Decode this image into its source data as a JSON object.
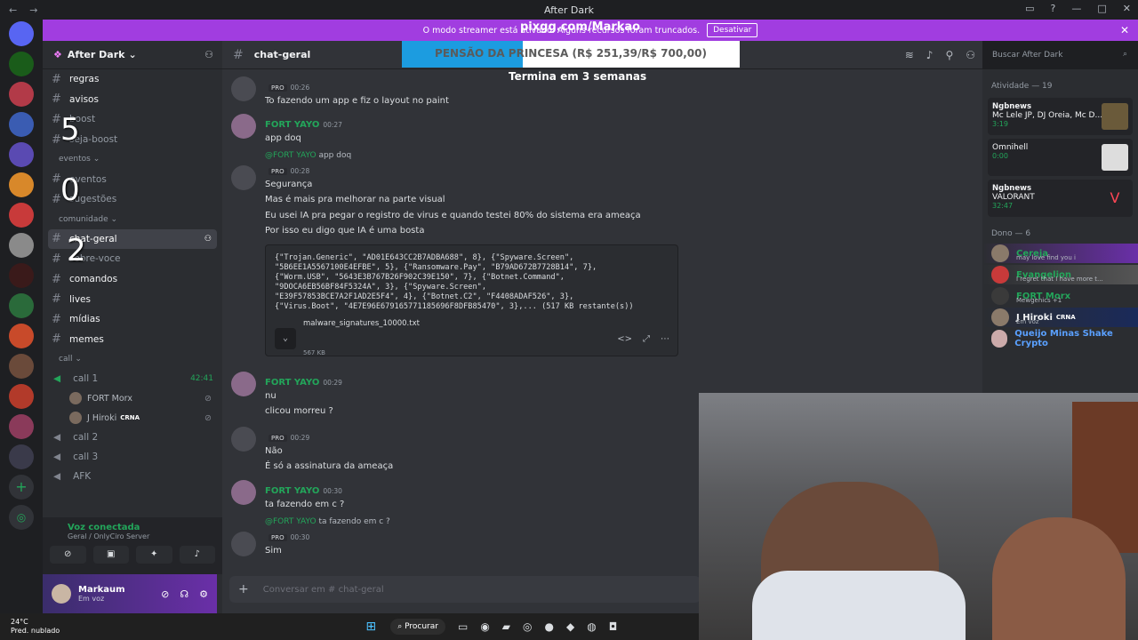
{
  "window": {
    "title": "After Dark",
    "nav_back": "←",
    "nav_fwd": "→"
  },
  "banner": {
    "text": "O modo streamer está ativado. Alguns recursos foram truncados.",
    "button": "Desativar",
    "close": "✕"
  },
  "overlay": {
    "url": "pixgg.com/Markao",
    "donation": "PENSÃO DA PRINCESA (R$ 251,39/R$ 700,00)",
    "donation_progress": 0.359,
    "timer": "Termina em 3 semanas",
    "nums": [
      "5",
      "0",
      "2"
    ]
  },
  "server": {
    "name": "After Dark"
  },
  "channels": [
    {
      "label": "regras",
      "bright": true
    },
    {
      "label": "avisos",
      "bright": true
    },
    {
      "label": "boost",
      "bright": false
    },
    {
      "label": "seja-boost",
      "bright": false
    }
  ],
  "category_eventos": "eventos",
  "channels_eventos": [
    {
      "label": "eventos"
    },
    {
      "label": "sugestões"
    }
  ],
  "category_comunidade": "comunidade",
  "channels_comunidade": [
    {
      "label": "chat-geral",
      "active": true
    },
    {
      "label": "sobre-voce"
    },
    {
      "label": "comandos",
      "bright": true
    },
    {
      "label": "lives",
      "bright": true
    },
    {
      "label": "mídias",
      "bright": true
    },
    {
      "label": "memes",
      "bright": true
    }
  ],
  "category_call": "call",
  "voice": {
    "call1": "call 1",
    "call1_time": "42:41",
    "users": [
      {
        "name": "FORT Morx",
        "tag": ""
      },
      {
        "name": "J Hiroki",
        "tag": "CRNA"
      }
    ],
    "call2": "call 2",
    "call3": "call 3",
    "afk": "AFK"
  },
  "voicebar": {
    "status": "Voz conectada",
    "sub": "Geral / OnlyCiro Server"
  },
  "user": {
    "name": "Markaum",
    "status": "Em voz"
  },
  "chat": {
    "channel": "chat-geral",
    "search_placeholder": "Buscar After Dark",
    "composer_placeholder": "Conversar em # chat-geral",
    "messages": {
      "m1": {
        "time": "00:26",
        "badge": "PRO",
        "text": "To fazendo um app e fiz o layout no paint"
      },
      "m2": {
        "user": "FORT YAYO",
        "time": "00:27",
        "text": "app doq"
      },
      "m3": {
        "reply_user": "@FORT YAYO",
        "reply_text": "app doq",
        "badge": "PRO",
        "time": "00:28",
        "lines": [
          "Segurança",
          "Mas é mais pra melhorar na parte visual",
          "Eu usei IA pra pegar o registro de virus e quando testei 80% do sistema era ameaça",
          "Por isso eu digo que IA é uma bosta"
        ]
      },
      "code": "{\"Trojan.Generic\", \"AD01E643CC2B7ADBA688\", 8}, {\"Spyware.Screen\",\n\"5B6EE1A5567100E4EFBE\", 5}, {\"Ransomware.Pay\", \"B79AD672B7728B14\", 7},\n{\"Worm.USB\", \"5643E3B767B26F902C39E150\", 7}, {\"Botnet.Command\",\n\"9DOCA6EB56BF84F5324A\", 3}, {\"Spyware.Screen\",\n\"E39F57853BCE7A2F1AD2E5F4\", 4}, {\"Botnet.C2\", \"F4408ADAF526\", 3},\n{\"Virus.Boot\", \"4E7E96E679165771185696F8DFB85470\", 3},... (517 KB restante(s))",
      "file": {
        "name": "malware_signatures_10000.txt",
        "size": "567 KB"
      },
      "m4": {
        "user": "FORT YAYO",
        "time": "00:29",
        "lines": [
          "nu",
          "clicou morreu ?"
        ]
      },
      "m5": {
        "badge": "PRO",
        "time": "00:29",
        "lines": [
          "Não",
          "É só a assinatura da ameaça"
        ]
      },
      "m6": {
        "user": "FORT YAYO",
        "time": "00:30",
        "text": "ta fazendo em c ?"
      },
      "m7": {
        "reply_user": "@FORT YAYO",
        "reply_text": "ta fazendo em c ?",
        "badge": "PRO",
        "time": "00:30",
        "text": "Sim"
      }
    }
  },
  "members": {
    "activity_header": "Atividade — 19",
    "activities": [
      {
        "title": "Ngbnews",
        "line": "Mc Lele JP, DJ Oreia, Mc D...",
        "time": "3:19"
      },
      {
        "title": "",
        "line": "Omnihell",
        "time": "0:00"
      },
      {
        "title": "Ngbnews",
        "line": "VALORANT",
        "time": "32:47"
      }
    ],
    "owner_header": "Dono — 6",
    "list": [
      {
        "name": "Cereja",
        "status": "may love find you i",
        "color": "#23a55a"
      },
      {
        "name": "Evangelion",
        "status": "I regret that I have more t...",
        "color": "#23a55a"
      },
      {
        "name": "FORT Morx",
        "status": "Mewgenics +1",
        "color": "#23a55a"
      },
      {
        "name": "J Hiroki",
        "status": "Em voz",
        "color": "#f2f3f5",
        "tag": "CRNA"
      },
      {
        "name": "Queijo Minas Shake Crypto",
        "status": "",
        "color": "#5aa0ff"
      }
    ]
  },
  "taskbar": {
    "temp": "24°C",
    "weather": "Pred. nublado",
    "search": "Procurar"
  }
}
